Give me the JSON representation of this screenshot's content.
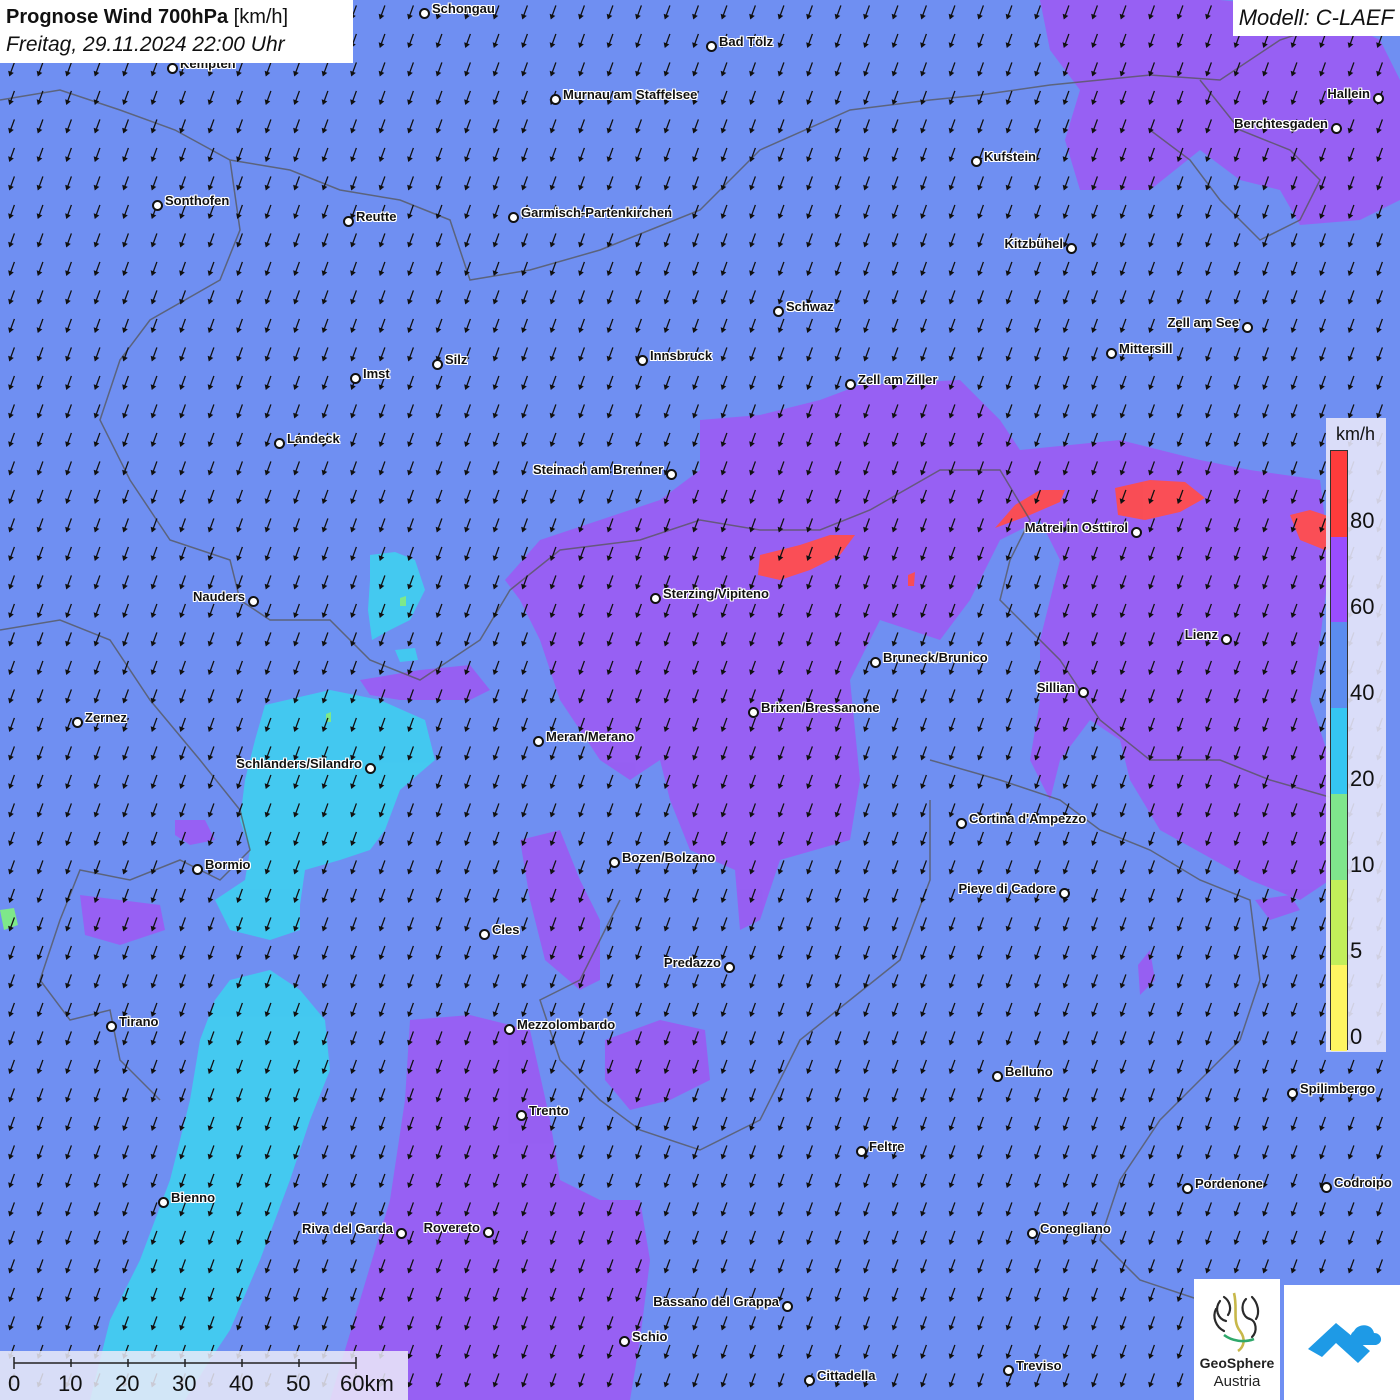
{
  "title": {
    "main": "Prognose Wind 700hPa",
    "unit": "[km/h]",
    "datetime": "Freitag, 29.11.2024 22:00 Uhr"
  },
  "model_label": "Modell: C-LAEF",
  "legend": {
    "unit": "km/h",
    "ticks": [
      "80",
      "60",
      "40",
      "20",
      "10",
      "5",
      "0"
    ],
    "colors": [
      "#ff3b3b",
      "#9a4dff",
      "#5b8cf0",
      "#35c6f2",
      "#7fe68c",
      "#c2ef5a",
      "#fff562"
    ]
  },
  "scale": {
    "labels": [
      "0",
      "10",
      "20",
      "30",
      "40",
      "50",
      "60km"
    ]
  },
  "colors": {
    "background_blue": "#6f8ff2",
    "purple": "#9a5cf3",
    "cyan": "#3fcff0",
    "red": "#ff4d4d",
    "green": "#7ee88a"
  },
  "wind_arrow_direction": "south-southwest",
  "cities": [
    {
      "name": "Schongau",
      "dot_side": "left"
    },
    {
      "name": "Bad Tölz",
      "dot_side": "left"
    },
    {
      "name": "Kempten",
      "dot_side": "left"
    },
    {
      "name": "Murnau am Staffelsee",
      "dot_side": "left"
    },
    {
      "name": "Hallein",
      "dot_side": "right"
    },
    {
      "name": "Berchtesgaden",
      "dot_side": "right"
    },
    {
      "name": "Kufstein",
      "dot_side": "left"
    },
    {
      "name": "Sonthofen",
      "dot_side": "left"
    },
    {
      "name": "Reutte",
      "dot_side": "left"
    },
    {
      "name": "Garmisch-Partenkirchen",
      "dot_side": "left"
    },
    {
      "name": "Kitzbühel",
      "dot_side": "right"
    },
    {
      "name": "Schwaz",
      "dot_side": "left"
    },
    {
      "name": "Zell am See",
      "dot_side": "right"
    },
    {
      "name": "Mittersill",
      "dot_side": "left"
    },
    {
      "name": "Innsbruck",
      "dot_side": "left"
    },
    {
      "name": "Imst",
      "dot_side": "left"
    },
    {
      "name": "Silz",
      "dot_side": "left"
    },
    {
      "name": "Zell am Ziller",
      "dot_side": "left"
    },
    {
      "name": "Landeck",
      "dot_side": "left"
    },
    {
      "name": "Steinach am Brenner",
      "dot_side": "right"
    },
    {
      "name": "Matrei in Osttirol",
      "dot_side": "right"
    },
    {
      "name": "Nauders",
      "dot_side": "right"
    },
    {
      "name": "Sterzing/Vipiteno",
      "dot_side": "left"
    },
    {
      "name": "Lienz",
      "dot_side": "right"
    },
    {
      "name": "Bruneck/Brunico",
      "dot_side": "left"
    },
    {
      "name": "Sillian",
      "dot_side": "right"
    },
    {
      "name": "Brixen/Bressanone",
      "dot_side": "left"
    },
    {
      "name": "Zernez",
      "dot_side": "left"
    },
    {
      "name": "Meran/Merano",
      "dot_side": "left"
    },
    {
      "name": "Schlanders/Silandro",
      "dot_side": "right"
    },
    {
      "name": "Cortina d'Ampezzo",
      "dot_side": "left"
    },
    {
      "name": "Bozen/Bolzano",
      "dot_side": "left"
    },
    {
      "name": "Bormio",
      "dot_side": "left"
    },
    {
      "name": "Pieve di Cadore",
      "dot_side": "right"
    },
    {
      "name": "Cles",
      "dot_side": "left"
    },
    {
      "name": "Predazzo",
      "dot_side": "right"
    },
    {
      "name": "Tirano",
      "dot_side": "left"
    },
    {
      "name": "Mezzolombardo",
      "dot_side": "left"
    },
    {
      "name": "Belluno",
      "dot_side": "left"
    },
    {
      "name": "Spilimbergo",
      "dot_side": "left"
    },
    {
      "name": "Trento",
      "dot_side": "left"
    },
    {
      "name": "Feltre",
      "dot_side": "left"
    },
    {
      "name": "Pordenone",
      "dot_side": "left"
    },
    {
      "name": "Codroipo",
      "dot_side": "left"
    },
    {
      "name": "Bienno",
      "dot_side": "left"
    },
    {
      "name": "Riva del Garda",
      "dot_side": "right"
    },
    {
      "name": "Rovereto",
      "dot_side": "right"
    },
    {
      "name": "Conegliano",
      "dot_side": "left"
    },
    {
      "name": "Bassano del Grappa",
      "dot_side": "right"
    },
    {
      "name": "Schio",
      "dot_side": "left"
    },
    {
      "name": "Treviso",
      "dot_side": "left"
    },
    {
      "name": "Cittadella",
      "dot_side": "left"
    }
  ],
  "logo": {
    "line1": "GeoSphere",
    "line2": "Austria"
  }
}
